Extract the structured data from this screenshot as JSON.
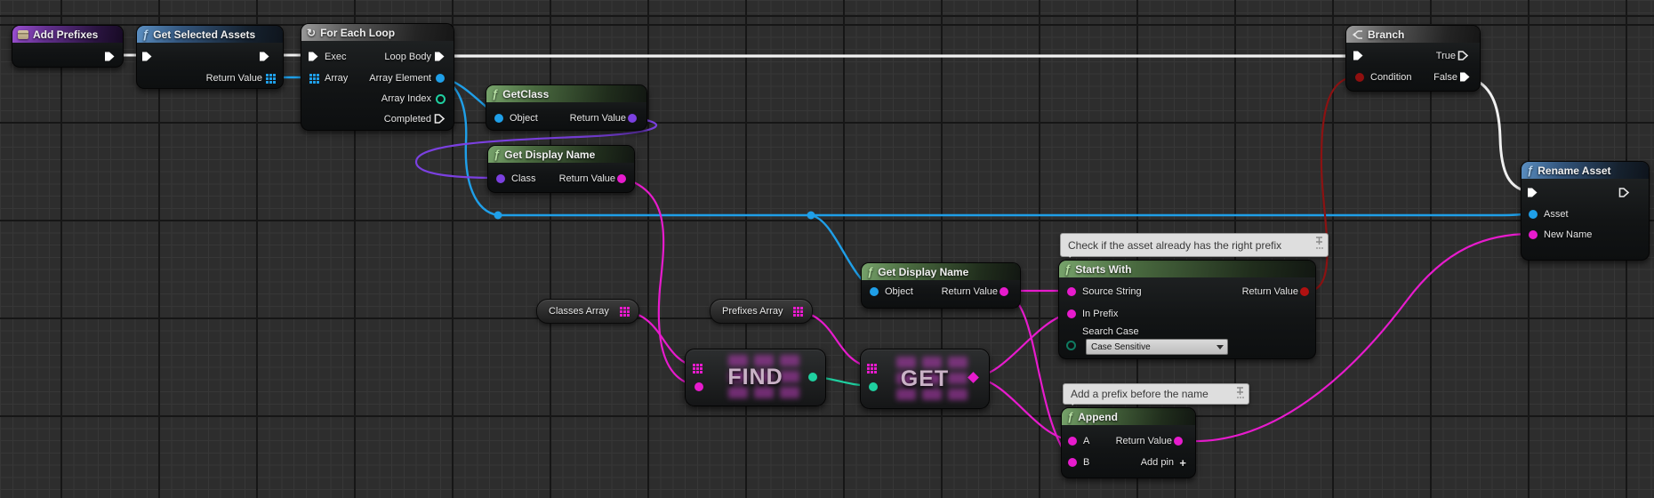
{
  "icons": {
    "function": "ƒ",
    "loop": "↻",
    "add_pin_plus": "+"
  },
  "colors": {
    "exec_wire": "#f0f0f0",
    "object_blue": "#1f9fe8",
    "class_purple": "#7b40e0",
    "string_pink": "#e71bcd",
    "int_teal": "#1fd0a0",
    "bool_red": "#b01111",
    "enum_green": "#0d6a55",
    "header_function": "#49693f",
    "header_pure_blue": "#33567e",
    "header_event": "#63308f",
    "header_macro": "#595959"
  },
  "nodes": {
    "add_prefixes": {
      "title": "Add Prefixes"
    },
    "get_selected_assets": {
      "title": "Get Selected Assets",
      "return_label": "Return Value"
    },
    "for_each_loop": {
      "title": "For Each Loop",
      "exec_label": "Exec",
      "array_label": "Array",
      "loop_body_label": "Loop Body",
      "array_element_label": "Array Element",
      "array_index_label": "Array Index",
      "completed_label": "Completed"
    },
    "get_class": {
      "title": "GetClass",
      "object_label": "Object",
      "return_label": "Return Value"
    },
    "get_display_name_class": {
      "title": "Get Display Name",
      "class_label": "Class",
      "return_label": "Return Value"
    },
    "classes_array": {
      "title": "Classes Array"
    },
    "prefixes_array": {
      "title": "Prefixes Array"
    },
    "find": {
      "label": "FIND"
    },
    "get": {
      "label": "GET"
    },
    "get_display_name_object": {
      "title": "Get Display Name",
      "object_label": "Object",
      "return_label": "Return Value"
    },
    "starts_with": {
      "title": "Starts With",
      "source_string_label": "Source String",
      "in_prefix_label": "In Prefix",
      "search_case_label": "Search Case",
      "search_case_value": "Case Sensitive",
      "return_label": "Return Value"
    },
    "append": {
      "title": "Append",
      "a_label": "A",
      "b_label": "B",
      "return_label": "Return Value",
      "add_pin_label": "Add pin"
    },
    "branch": {
      "title": "Branch",
      "condition_label": "Condition",
      "true_label": "True",
      "false_label": "False"
    },
    "rename_asset": {
      "title": "Rename Asset",
      "asset_label": "Asset",
      "new_name_label": "New Name"
    }
  },
  "comments": {
    "check_prefix": "Check if the asset already has the right prefix",
    "add_prefix": "Add a prefix before the name"
  }
}
